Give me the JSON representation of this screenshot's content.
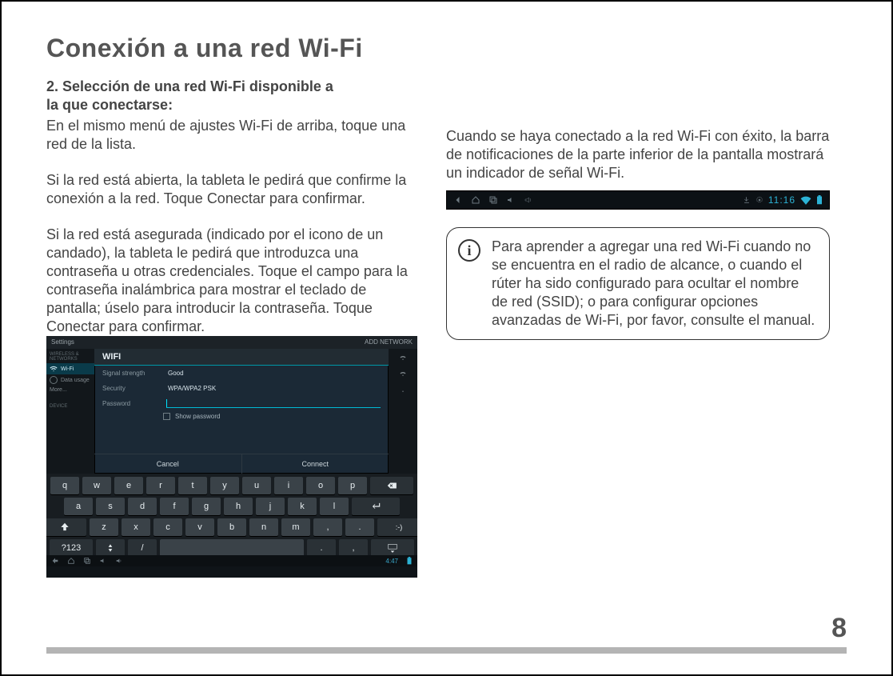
{
  "page": {
    "title": "Conexión a una red Wi-Fi",
    "number": "8"
  },
  "left": {
    "step_heading_l1": "2. Selección de una red Wi-Fi disponible a",
    "step_heading_l2": " la que conectarse:",
    "p1": "En el mismo menú de ajustes Wi-Fi de arriba, toque una red de la lista.",
    "p2": "Si la red está abierta, la tableta le pedirá que confirme la conexión a la red. Toque Conectar para confirmar.",
    "p3": "Si la red está asegurada (indicado por el icono de un candado), la tableta le pedirá que introduzca una contraseña u otras credenciales. Toque el campo para la contraseña inalámbrica para mostrar el teclado de pantalla; úselo para introducir la contraseña. Toque Conectar para confirmar."
  },
  "right": {
    "p1": "Cuando se haya conectado a la red Wi-Fi con éxito, la barra de notificaciones de la parte inferior de la pantalla mostrará un indicador de señal Wi-Fi.",
    "info": "Para aprender a agregar una red Wi-Fi cuando no se encuentra en el radio de alcance, o cuando el rúter ha sido configurado para ocultar el nombre de red (SSID); o para configurar opciones avanzadas de Wi-Fi, por favor, consulte el manual."
  },
  "wifi_dialog": {
    "settings_label": "Settings",
    "add_network": "ADD NETWORK",
    "title": "WIFI",
    "signal_label": "Signal strength",
    "signal_value": "Good",
    "security_label": "Security",
    "security_value": "WPA/WPA2 PSK",
    "password_label": "Password",
    "show_password": "Show password",
    "cancel": "Cancel",
    "connect": "Connect",
    "nav_wireless": "WIRELESS & NETWORKS",
    "nav_wifi": "Wi-Fi",
    "nav_data": "Data usage",
    "nav_more": "More...",
    "nav_device": "DEVICE",
    "clock": "4:47"
  },
  "notif": {
    "clock": "11:16"
  },
  "keyboard": {
    "row1": [
      "q",
      "w",
      "e",
      "r",
      "t",
      "y",
      "u",
      "i",
      "o",
      "p"
    ],
    "row2": [
      "a",
      "s",
      "d",
      "f",
      "g",
      "h",
      "j",
      "k",
      "l"
    ],
    "row3": [
      "z",
      "x",
      "c",
      "v",
      "b",
      "n",
      "m",
      ",",
      "."
    ],
    "sym": "?123",
    "slash": "/"
  }
}
